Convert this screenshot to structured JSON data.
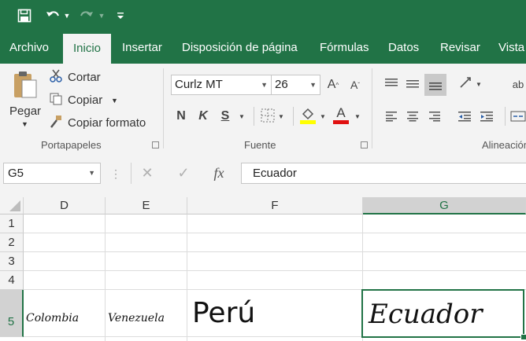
{
  "qat": {
    "save": "save-icon",
    "undo": "undo-icon",
    "redo": "redo-icon",
    "customize": "customize-qat-icon"
  },
  "tabs": [
    "Archivo",
    "Inicio",
    "Insertar",
    "Disposición de página",
    "Fórmulas",
    "Datos",
    "Revisar",
    "Vista"
  ],
  "active_tab": "Inicio",
  "clipboard": {
    "paste_label": "Pegar",
    "cut_label": "Cortar",
    "copy_label": "Copiar",
    "format_painter_label": "Copiar formato",
    "group_label": "Portapapeles"
  },
  "font": {
    "font_name": "Curlz MT",
    "font_size": "26",
    "bold": "N",
    "italic": "K",
    "underline": "S",
    "font_color_glyph": "A",
    "group_label": "Fuente",
    "highlight_color": "#ffff00",
    "font_color": "#e01010"
  },
  "alignment": {
    "group_label": "Alineación",
    "wrap_glyph": "ab"
  },
  "formula_bar": {
    "name_box": "G5",
    "fx": "fx",
    "content": "Ecuador"
  },
  "grid": {
    "columns": [
      "D",
      "E",
      "F",
      "G"
    ],
    "rows": [
      "1",
      "2",
      "3",
      "4",
      "5"
    ],
    "selected_column": "G",
    "selected_row": "5",
    "row5": {
      "D": "Colombia",
      "E": "Venezuela",
      "F": "Perú",
      "G": "Ecuador"
    }
  },
  "colors": {
    "accent": "#217346",
    "ribbon_bg": "#f3f3f3"
  }
}
